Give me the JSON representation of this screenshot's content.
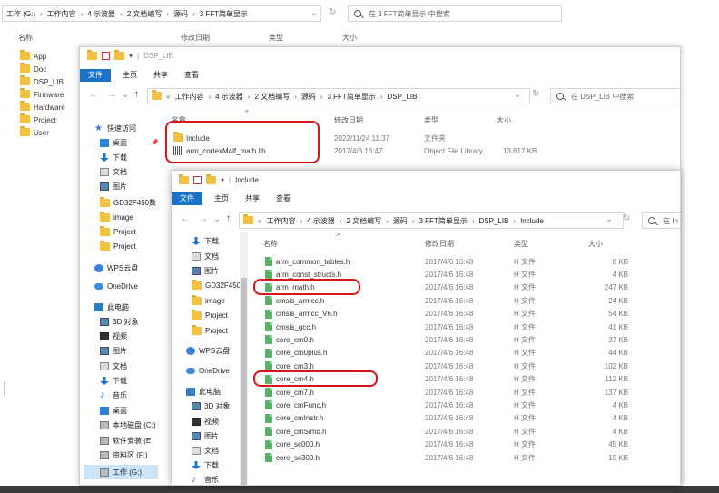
{
  "w1": {
    "address": [
      "工作 (G:)",
      "工作内容",
      "4 示波器",
      "2 文档编写",
      "源码",
      "3 FFT简单显示"
    ],
    "search_placeholder": "在 3 FFT简单显示 中搜索",
    "headers": {
      "name": "名称",
      "date": "修改日期",
      "type": "类型",
      "size": "大小"
    },
    "folders": [
      "App",
      "Doc",
      "DSP_LIB",
      "Firmware",
      "Hardware",
      "Project",
      "User"
    ]
  },
  "w2": {
    "title": "DSP_LIB",
    "ribbon": {
      "file": "文件",
      "home": "主页",
      "share": "共享",
      "view": "查看"
    },
    "address": [
      "工作内容",
      "4 示波器",
      "2 文档编写",
      "源码",
      "3 FFT简单显示",
      "DSP_LIB"
    ],
    "search_placeholder": "在 DSP_LIB 中搜索",
    "headers": {
      "name": "名称",
      "date": "修改日期",
      "type": "类型",
      "size": "大小"
    },
    "nav": [
      "快速访问",
      "桌面",
      "下载",
      "文档",
      "图片",
      "GD32F450数",
      "image",
      "Project",
      "Project",
      "WPS云盘",
      "OneDrive",
      "此电脑",
      "3D 对象",
      "视频",
      "图片",
      "文档",
      "下载",
      "音乐",
      "桌面",
      "本地磁盘 (C:)",
      "软件安装 (E",
      "资料区 (F:)",
      "工作 (G:)"
    ],
    "files": [
      {
        "name": "Include",
        "date": "2022/11/24 11:37",
        "type": "文件夹",
        "size": ""
      },
      {
        "name": "arm_cortexM4lf_math.lib",
        "date": "2017/4/6 16:47",
        "type": "Object File Library",
        "size": "13,617 KB"
      }
    ]
  },
  "w3": {
    "title": "Include",
    "ribbon": {
      "file": "文件",
      "home": "主页",
      "share": "共享",
      "view": "查看"
    },
    "address": [
      "工作内容",
      "4 示波器",
      "2 文档编写",
      "源码",
      "3 FFT简单显示",
      "DSP_LIB",
      "Include"
    ],
    "search_placeholder": "在 In",
    "headers": {
      "name": "名称",
      "date": "修改日期",
      "type": "类型",
      "size": "大小"
    },
    "nav": [
      "下载",
      "文档",
      "图片",
      "GD32F450",
      "image",
      "Project",
      "Project",
      "WPS云盘",
      "OneDrive",
      "此电脑",
      "3D 对象",
      "视频",
      "图片",
      "文档",
      "下载",
      "音乐"
    ],
    "files": [
      {
        "name": "arm_common_tables.h",
        "date": "2017/4/6 16:48",
        "type": "H 文件",
        "size": "8 KB"
      },
      {
        "name": "arm_const_structs.h",
        "date": "2017/4/6 16:48",
        "type": "H 文件",
        "size": "4 KB"
      },
      {
        "name": "arm_math.h",
        "date": "2017/4/6 16:48",
        "type": "H 文件",
        "size": "247 KB"
      },
      {
        "name": "cmsis_armcc.h",
        "date": "2017/4/6 16:48",
        "type": "H 文件",
        "size": "24 KB"
      },
      {
        "name": "cmsis_armcc_V6.h",
        "date": "2017/4/6 16:48",
        "type": "H 文件",
        "size": "54 KB"
      },
      {
        "name": "cmsis_gcc.h",
        "date": "2017/4/6 16:48",
        "type": "H 文件",
        "size": "41 KB"
      },
      {
        "name": "core_cm0.h",
        "date": "2017/4/6 16:48",
        "type": "H 文件",
        "size": "37 KB"
      },
      {
        "name": "core_cm0plus.h",
        "date": "2017/4/6 16:48",
        "type": "H 文件",
        "size": "44 KB"
      },
      {
        "name": "core_cm3.h",
        "date": "2017/4/6 16:48",
        "type": "H 文件",
        "size": "102 KB"
      },
      {
        "name": "core_cm4.h",
        "date": "2017/4/6 16:48",
        "type": "H 文件",
        "size": "112 KB"
      },
      {
        "name": "core_cm7.h",
        "date": "2017/4/6 16:48",
        "type": "H 文件",
        "size": "137 KB"
      },
      {
        "name": "core_cmFunc.h",
        "date": "2017/4/6 16:48",
        "type": "H 文件",
        "size": "4 KB"
      },
      {
        "name": "core_cmInstr.h",
        "date": "2017/4/6 16:48",
        "type": "H 文件",
        "size": "4 KB"
      },
      {
        "name": "core_cmSimd.h",
        "date": "2017/4/6 16:48",
        "type": "H 文件",
        "size": "4 KB"
      },
      {
        "name": "core_sc000.h",
        "date": "2017/4/6 16:48",
        "type": "H 文件",
        "size": "45 KB"
      },
      {
        "name": "core_sc300.h",
        "date": "2017/4/6 16:48",
        "type": "H 文件",
        "size": "19 KB"
      }
    ]
  }
}
